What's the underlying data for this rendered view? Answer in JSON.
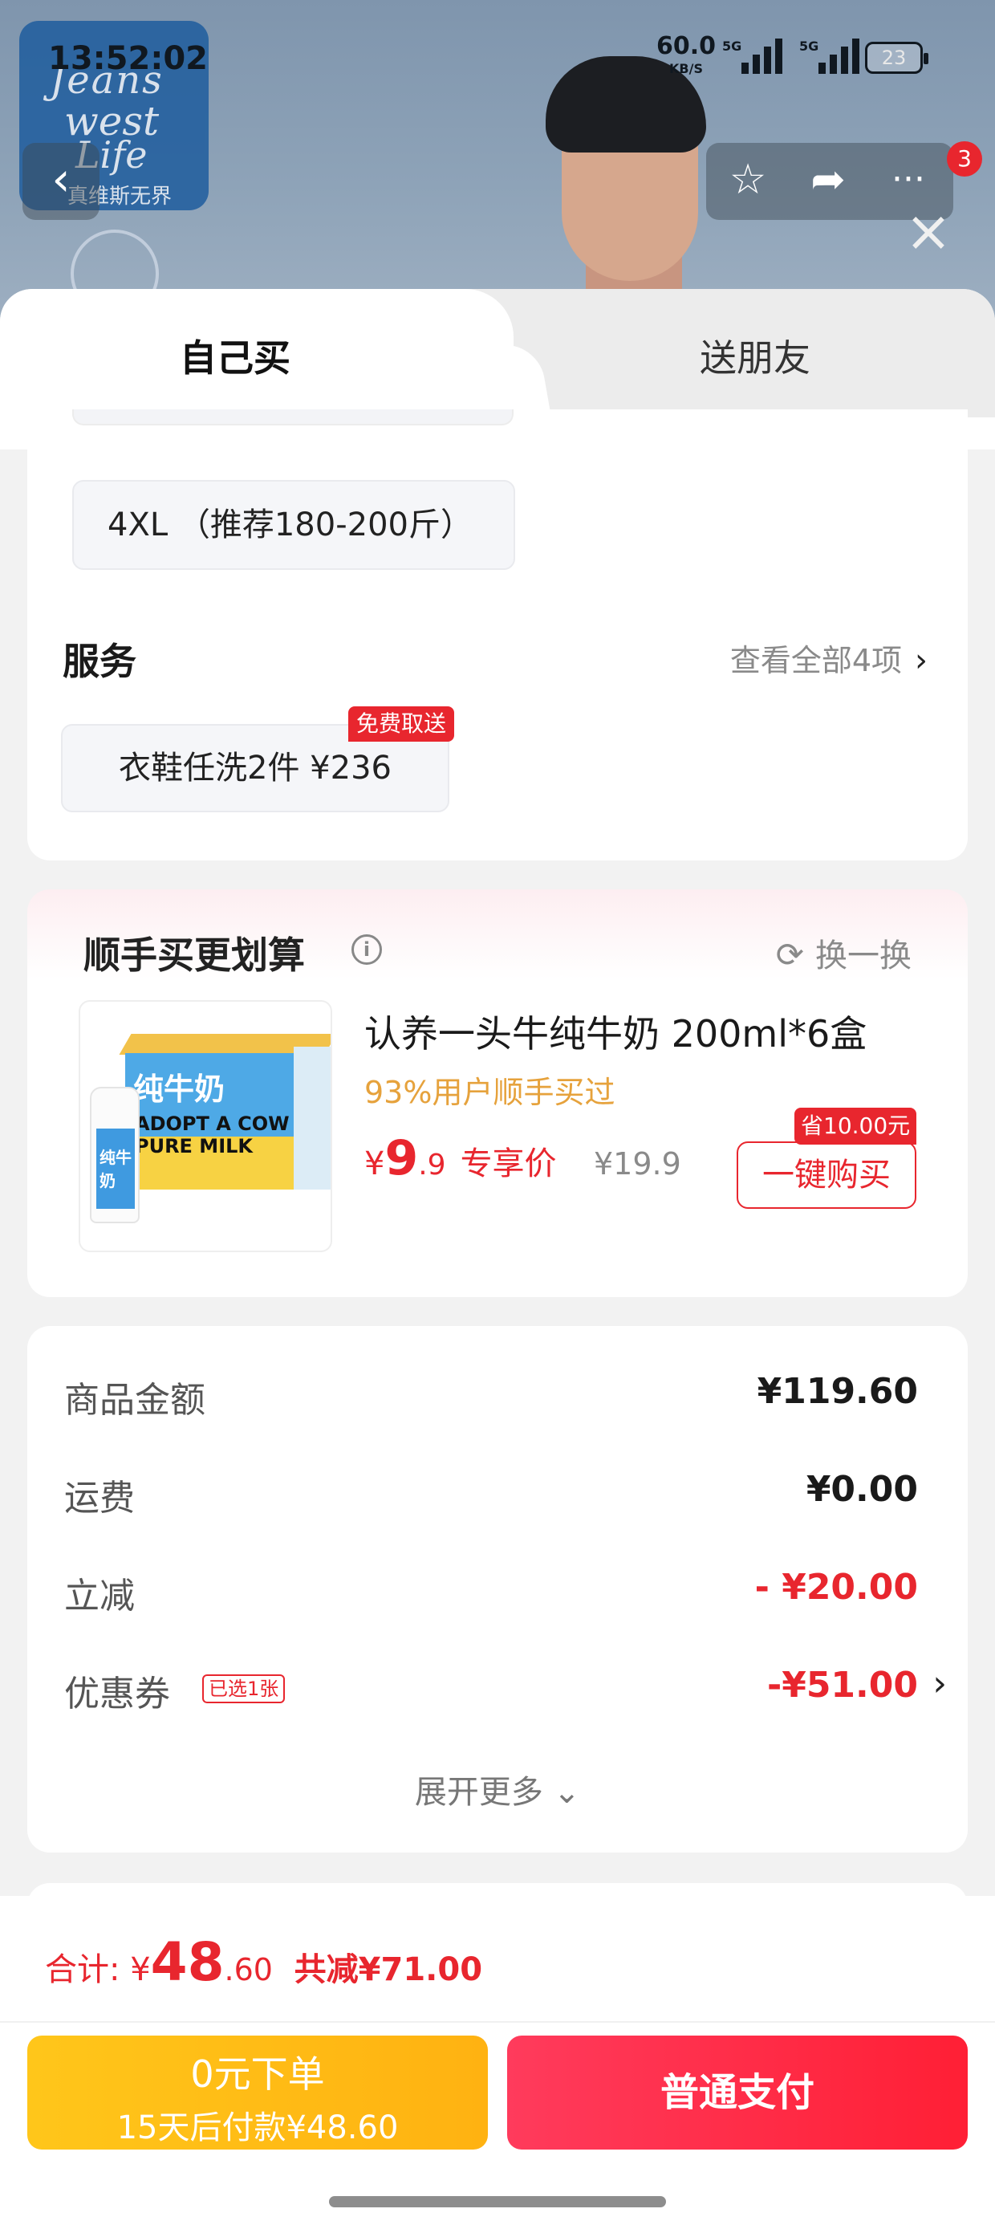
{
  "status_bar": {
    "time": "13:52:02",
    "net_speed": "60.0",
    "net_speed_unit": "KB/S",
    "signal_1": "5G",
    "signal_2": "5G",
    "battery": "23"
  },
  "background": {
    "brand_lines": [
      "Jeans",
      "west",
      "Life",
      "真维斯无界"
    ]
  },
  "top_actions": {
    "back_icon": "chevron-left",
    "favorite_icon": "star-outline",
    "share_icon": "share-arrow",
    "more_icon": "ellipsis",
    "more_badge": "3",
    "close_icon": "close-x"
  },
  "tabs": [
    {
      "label": "自己买",
      "active": true
    },
    {
      "label": "送朋友",
      "active": false
    }
  ],
  "spec": {
    "size_selected": "4XL （推荐180-200斤）"
  },
  "service": {
    "title": "服务",
    "view_all": "查看全部4项",
    "chip_label": "衣鞋任洗2件  ¥236",
    "chip_tag": "免费取送"
  },
  "addon": {
    "title": "顺手买更划算",
    "swap_label": "换一换",
    "product_name": "认养一头牛纯牛奶 200ml*6盒",
    "buyers_note": "93%用户顺手买过",
    "price_symbol": "¥",
    "price_int": "9",
    "price_dec": ".9",
    "price_label": "专享价",
    "orig_price": "¥19.9",
    "buy_button": "一键购买",
    "save_tag": "省10.00元",
    "image_text": {
      "main": "纯牛奶",
      "line1": "ADOPT A COW",
      "line2": "PURE MILK",
      "bottle": "纯牛奶"
    }
  },
  "summary": {
    "rows": [
      {
        "label": "商品金额",
        "value": "¥119.60",
        "red": false
      },
      {
        "label": "运费",
        "value": "¥0.00",
        "red": false
      },
      {
        "label": "立减",
        "value": "- ¥20.00",
        "red": true
      },
      {
        "label": "优惠券",
        "value": "-¥51.00",
        "red": true,
        "tag": "已选1张"
      }
    ],
    "expand": "展开更多"
  },
  "bottom": {
    "total_label": "合计:",
    "currency": "¥",
    "total_int": "48",
    "total_dec": ".60",
    "total_saved": "共减¥71.00",
    "zero_pay_title": "0元下单",
    "zero_pay_sub": "15天后付款¥48.60",
    "normal_pay": "普通支付"
  },
  "colors": {
    "accent_red": "#e8262e",
    "pay_yellow": "#ffb211",
    "pay_red": "#ff1f35",
    "buyers_orange": "#e6a23c"
  }
}
